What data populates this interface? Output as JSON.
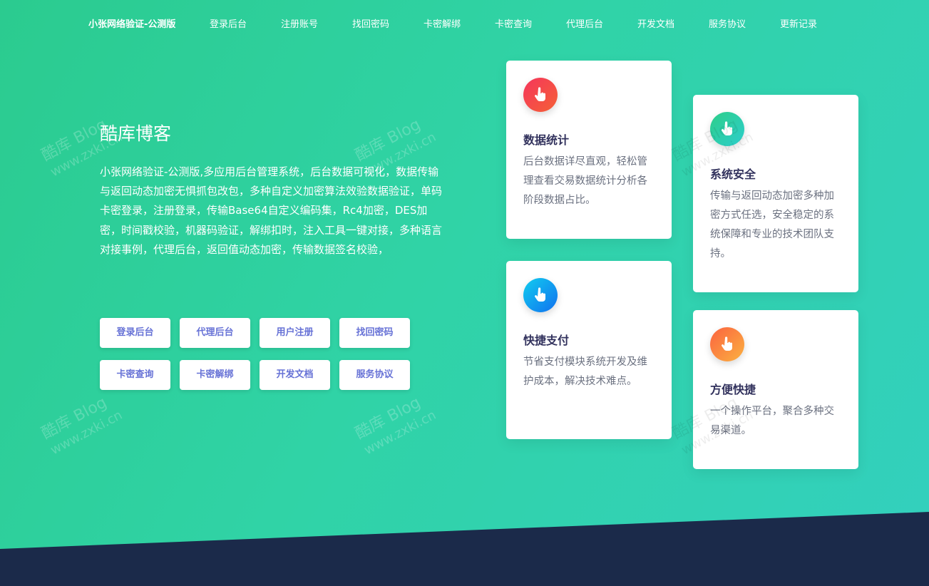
{
  "nav": {
    "brand": "小张网络验证-公测版",
    "links": [
      "登录后台",
      "注册账号",
      "找回密码",
      "卡密解绑",
      "卡密查询",
      "代理后台",
      "开发文档",
      "服务协议",
      "更新记录"
    ]
  },
  "hero": {
    "title": "酷库博客",
    "description": "小张网络验证-公测版,多应用后台管理系统，后台数据可视化，数据传输与返回动态加密无惧抓包改包，多种自定义加密算法效验数据验证，单码卡密登录，注册登录，传输Base64自定义编码集，Rc4加密，DES加密，时间戳校验，机器码验证，解绑扣时，注入工具一键对接，多种语言对接事例，代理后台，返回值动态加密，传输数据签名校验，",
    "buttons_row1": [
      "登录后台",
      "代理后台",
      "用户注册",
      "找回密码"
    ],
    "buttons_row2": [
      "卡密查询",
      "卡密解绑",
      "开发文档",
      "服务协议"
    ]
  },
  "cards": [
    {
      "title": "数据统计",
      "text": "后台数据详尽直观，轻松管理查看交易数据统计分析各阶段数据占比。",
      "icon": "hand-pointer-icon",
      "color": "#f5365c"
    },
    {
      "title": "系统安全",
      "text": "传输与返回动态加密多种加密方式任选，安全稳定的系统保障和专业的技术团队支持。",
      "icon": "hand-pointer-icon",
      "color": "#2dce89"
    },
    {
      "title": "快捷支付",
      "text": "节省支付模块系统开发及维护成本，解决技术难点。",
      "icon": "hand-pointer-icon",
      "color": "#1171ef"
    },
    {
      "title": "方便快捷",
      "text": "一个操作平台，聚合多种交易渠道。",
      "icon": "hand-pointer-icon",
      "color": "#fb6340"
    }
  ],
  "watermark": {
    "line1": "酷库 Blog",
    "line2": "www.zxki.cn"
  },
  "colors": {
    "accent": "#6772d6",
    "footer": "#1b2a4a",
    "title": "#32325d"
  }
}
